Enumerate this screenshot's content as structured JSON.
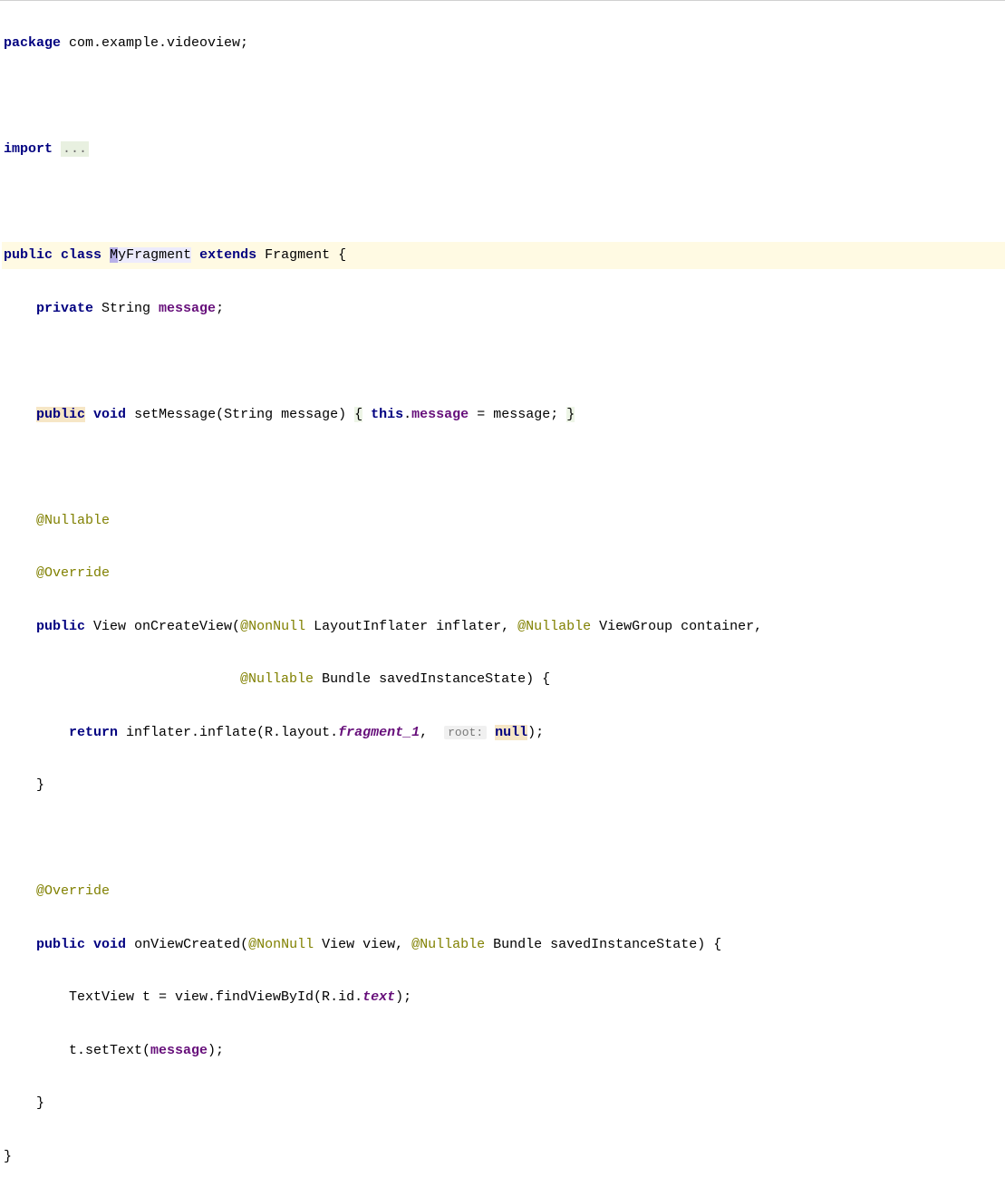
{
  "code": {
    "package_kw": "package",
    "package_name": " com.example.videoview;",
    "import_kw": "import",
    "import_ellipsis": "...",
    "public_kw": "public",
    "class_kw": "class",
    "class_name": "MyFragment",
    "extends_kw": "extends",
    "parent_class": " Fragment {",
    "private_kw": "private",
    "string_type": " String ",
    "message_field": "message",
    "semicolon": ";",
    "void_kw": "void",
    "setMessage_name": " setMessage(String message) ",
    "this_kw": "this",
    "dot_message": ".",
    "eq_message": " = message; ",
    "open_brace": "{",
    "close_brace": "}",
    "nullable_ann": "@Nullable",
    "override_ann": "@Override",
    "nonnull_ann": "@NonNull",
    "view_type": " View onCreateView(",
    "layoutinflater": " LayoutInflater inflater, ",
    "viewgroup": " ViewGroup container,",
    "bundle1": " Bundle savedInstanceState) {",
    "bundle2": " Bundle savedInstanceState) {",
    "return_kw": "return",
    "inflate_call": " inflater.inflate(R.layout.",
    "fragment1": "fragment_1",
    "comma_space": ",  ",
    "root_hint": "root:",
    "null_kw": "null",
    "close_call": ");",
    "close_brace_only": "}",
    "onviewcreated": " onViewCreated(",
    "view_param": " View view, ",
    "textview_line": "TextView t = view.findViewById(R.id.",
    "text_field": "text",
    "close_paren_semi": ");",
    "tsettext": "t.setText(",
    "msg_arg": "message",
    "close_paren_semi2": ");",
    "space1": " ",
    "space_public": "public "
  }
}
